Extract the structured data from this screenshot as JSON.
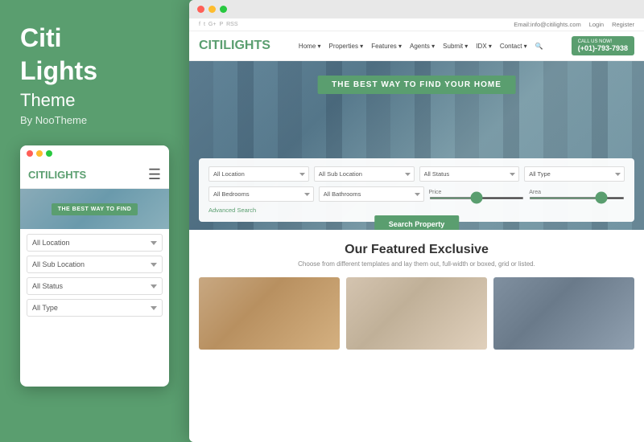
{
  "left": {
    "brand": {
      "line1": "Citi",
      "line2": "Lights",
      "subtitle": "Theme",
      "by": "By NooTheme"
    },
    "mobile": {
      "logo_citi": "CITI",
      "logo_lights": "LIGHTS",
      "hero_text": "THE BEST WAY TO FIND",
      "selects": [
        {
          "label": "All Location"
        },
        {
          "label": "All Sub Location"
        },
        {
          "label": "All Status"
        },
        {
          "label": "All Type"
        }
      ]
    }
  },
  "right": {
    "titlebar_dots": [
      "red",
      "yellow",
      "green"
    ],
    "topbar": {
      "email": "Email:info@citilights.com",
      "login": "Login",
      "register": "Register"
    },
    "nav": {
      "logo_citi": "CITI",
      "logo_lights": "LIGHTS",
      "links": [
        "Home",
        "Properties",
        "Features",
        "Agents",
        "Submit",
        "IDX",
        "Contact"
      ],
      "phone_label": "CALL US NOW!",
      "phone": "(+01)-793-7938"
    },
    "hero": {
      "banner": "THE BEST WAY TO FIND YOUR HOME",
      "search_btn": "Search Property",
      "selects_row1": [
        "All Location",
        "All Sub Location",
        "All Status",
        "All Type"
      ],
      "selects_row2": [
        "All Bedrooms",
        "All Bathrooms"
      ],
      "price_label": "Price",
      "area_label": "Area",
      "advanced_link": "Advanced Search"
    },
    "featured": {
      "title": "Our Featured Exclusive",
      "subtitle": "Choose from different templates and lay them out, full-width or boxed, grid or listed."
    }
  }
}
